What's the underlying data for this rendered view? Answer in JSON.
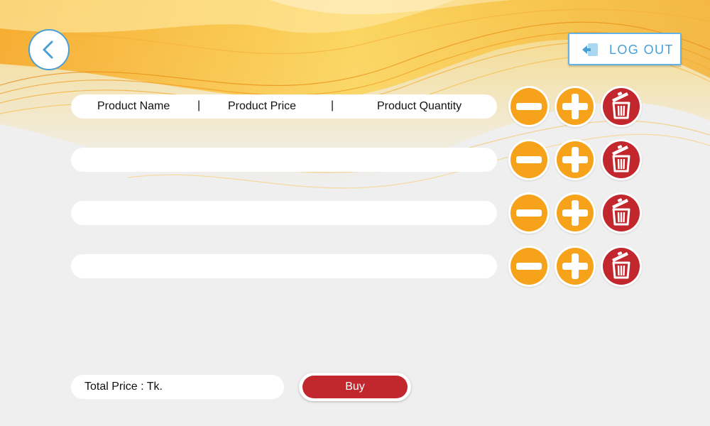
{
  "header": {
    "back_icon": "chevron-left-icon",
    "logout_label": "LOG OUT",
    "logout_icon": "logout-arrow-icon"
  },
  "table": {
    "columns": [
      "Product Name",
      "Product Price",
      "Product Quantity"
    ],
    "separator": "|",
    "rows": [
      {
        "name": "",
        "price": "",
        "quantity": ""
      },
      {
        "name": "",
        "price": "",
        "quantity": ""
      },
      {
        "name": "",
        "price": "",
        "quantity": ""
      }
    ],
    "row_actions": [
      "minus-icon",
      "plus-icon",
      "trash-icon"
    ]
  },
  "footer": {
    "total_label": "Total Price : Tk.",
    "buy_label": "Buy"
  },
  "colors": {
    "accent_orange": "#f7a21b",
    "delete_red": "#c1272d",
    "link_blue": "#4a9fd4",
    "background": "#efefef"
  }
}
